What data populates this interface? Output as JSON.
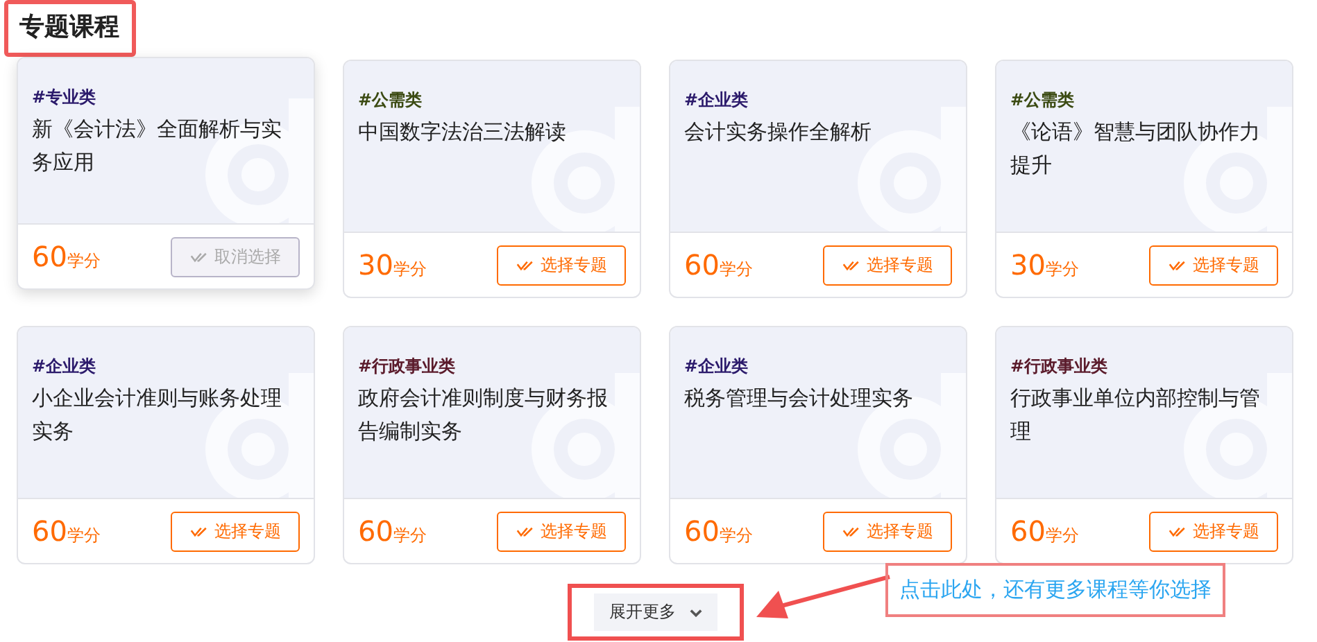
{
  "section_title": "专题课程",
  "courses": [
    {
      "tag": "#专业类",
      "color": "#2b1a6b",
      "title": "新《会计法》全面解析与实务应用",
      "credits": "60",
      "unit": "学分",
      "button": "取消选择",
      "selected": true
    },
    {
      "tag": "#公需类",
      "color": "#3b4a12",
      "title": "中国数字法治三法解读",
      "credits": "30",
      "unit": "学分",
      "button": "选择专题",
      "selected": false
    },
    {
      "tag": "#企业类",
      "color": "#2b1a6b",
      "title": "会计实务操作全解析",
      "credits": "60",
      "unit": "学分",
      "button": "选择专题",
      "selected": false
    },
    {
      "tag": "#公需类",
      "color": "#3b4a12",
      "title": "《论语》智慧与团队协作力提升",
      "credits": "30",
      "unit": "学分",
      "button": "选择专题",
      "selected": false
    },
    {
      "tag": "#企业类",
      "color": "#2b1a6b",
      "title": "小企业会计准则与账务处理实务",
      "credits": "60",
      "unit": "学分",
      "button": "选择专题",
      "selected": false
    },
    {
      "tag": "#行政事业类",
      "color": "#5a1a2a",
      "title": "政府会计准则制度与财务报告编制实务",
      "credits": "60",
      "unit": "学分",
      "button": "选择专题",
      "selected": false
    },
    {
      "tag": "#企业类",
      "color": "#2b1a6b",
      "title": "税务管理与会计处理实务",
      "credits": "60",
      "unit": "学分",
      "button": "选择专题",
      "selected": false
    },
    {
      "tag": "#行政事业类",
      "color": "#5a1a2a",
      "title": "行政事业单位内部控制与管理",
      "credits": "60",
      "unit": "学分",
      "button": "选择专题",
      "selected": false
    }
  ],
  "expand_button": "展开更多",
  "callout": "点击此处，还有更多课程等你选择"
}
